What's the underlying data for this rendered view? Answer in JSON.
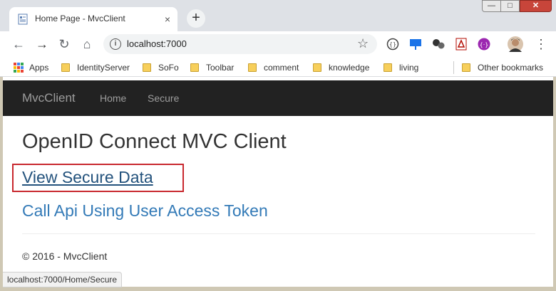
{
  "window": {
    "tab_title": "Home Page - MvcClient",
    "tab_close": "×",
    "new_tab": "+",
    "controls": {
      "minimize": "—",
      "maximize": "□",
      "close": "✕"
    }
  },
  "toolbar": {
    "back": "←",
    "forward": "→",
    "reload": "↻",
    "home": "⌂",
    "url": "localhost:7000",
    "info_symbol": "i",
    "star": "☆",
    "menu": "⋮"
  },
  "bookmarks": {
    "items": [
      {
        "label": "Apps"
      },
      {
        "label": "IdentityServer"
      },
      {
        "label": "SoFo"
      },
      {
        "label": "Toolbar"
      },
      {
        "label": "comment"
      },
      {
        "label": "knowledge"
      },
      {
        "label": "living"
      }
    ],
    "other": "Other bookmarks"
  },
  "page": {
    "brand": "MvcClient",
    "nav": [
      "Home",
      "Secure"
    ],
    "heading": "OpenID Connect MVC Client",
    "link_secure": "View Secure Data",
    "link_api": "Call Api Using User Access Token",
    "footer": "© 2016 - MvcClient"
  },
  "status": {
    "url": "localhost:7000/Home/Secure"
  },
  "colors": {
    "navbar": "#222222",
    "link": "#337ab7",
    "link_visited": "#23527c",
    "highlight_box": "#c8282e"
  }
}
